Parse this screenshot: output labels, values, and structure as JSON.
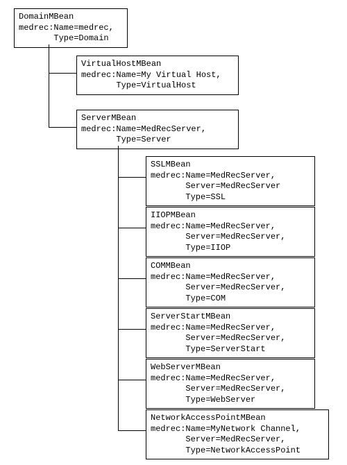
{
  "nodes": {
    "domain": {
      "title": "DomainMBean",
      "line1": "medrec:Name=medrec,",
      "line2": "       Type=Domain"
    },
    "virtualhost": {
      "title": "VirtualHostMBean",
      "line1": "medrec:Name=My Virtual Host,",
      "line2": "       Type=VirtualHost"
    },
    "server": {
      "title": "ServerMBean",
      "line1": "medrec:Name=MedRecServer,",
      "line2": "       Type=Server"
    },
    "ssl": {
      "title": "SSLMBean",
      "line1": "medrec:Name=MedRecServer,",
      "line2": "       Server=MedRecServer",
      "line3": "       Type=SSL"
    },
    "iiop": {
      "title": "IIOPMBean",
      "line1": "medrec:Name=MedRecServer,",
      "line2": "       Server=MedRecServer,",
      "line3": "       Type=IIOP"
    },
    "com": {
      "title": "COMMBean",
      "line1": "medrec:Name=MedRecServer,",
      "line2": "       Server=MedRecServer,",
      "line3": "       Type=COM"
    },
    "serverstart": {
      "title": "ServerStartMBean",
      "line1": "medrec:Name=MedRecServer,",
      "line2": "       Server=MedRecServer,",
      "line3": "       Type=ServerStart"
    },
    "webserver": {
      "title": "WebServerMBean",
      "line1": "medrec:Name=MedRecServer,",
      "line2": "       Server=MedRecServer,",
      "line3": "       Type=WebServer"
    },
    "nap": {
      "title": "NetworkAccessPointMBean",
      "line1": "medrec:Name=MyNetwork Channel,",
      "line2": "       Server=MedRecServer,",
      "line3": "       Type=NetworkAccessPoint"
    }
  }
}
